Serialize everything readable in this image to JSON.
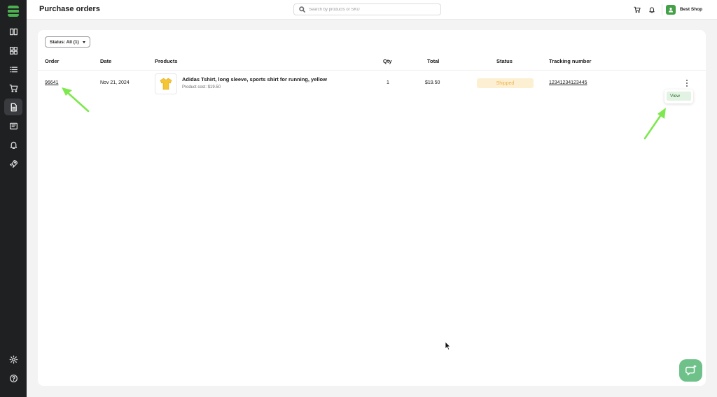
{
  "header": {
    "title": "Purchase orders",
    "search_placeholder": "Search by products or SKU",
    "shop_name": "Best Shop"
  },
  "sidebar": {
    "items": [
      {
        "icon": "catalog-icon"
      },
      {
        "icon": "grid-icon"
      },
      {
        "icon": "list-icon"
      },
      {
        "icon": "cart-icon"
      },
      {
        "icon": "document-icon",
        "active": true
      },
      {
        "icon": "wallet-icon"
      },
      {
        "icon": "bell-icon"
      },
      {
        "icon": "rocket-icon"
      },
      {
        "icon": "settings-icon"
      },
      {
        "icon": "help-icon"
      }
    ]
  },
  "filter": {
    "status_label": "Status: All (1)"
  },
  "table": {
    "headers": {
      "order": "Order",
      "date": "Date",
      "products": "Products",
      "qty": "Qty",
      "total": "Total",
      "status": "Status",
      "tracking": "Tracking number"
    },
    "rows": [
      {
        "order": "96641",
        "date": "Nov 21, 2024",
        "product_name": "Adidas Tshirt, long sleeve, sports shirt for running, yellow",
        "product_cost": "Product cost: $19.50",
        "qty": "1",
        "total": "$19.50",
        "status": "Shipped",
        "tracking": "12341234123445"
      }
    ]
  },
  "row_menu": {
    "view_label": "View"
  },
  "colors": {
    "accent": "#4caf50",
    "annotation_arrow": "#7ee84f",
    "status_shipped_bg": "#fdf0d2",
    "status_shipped_text": "#f0b24a",
    "sidebar_bg": "#1f2022"
  }
}
